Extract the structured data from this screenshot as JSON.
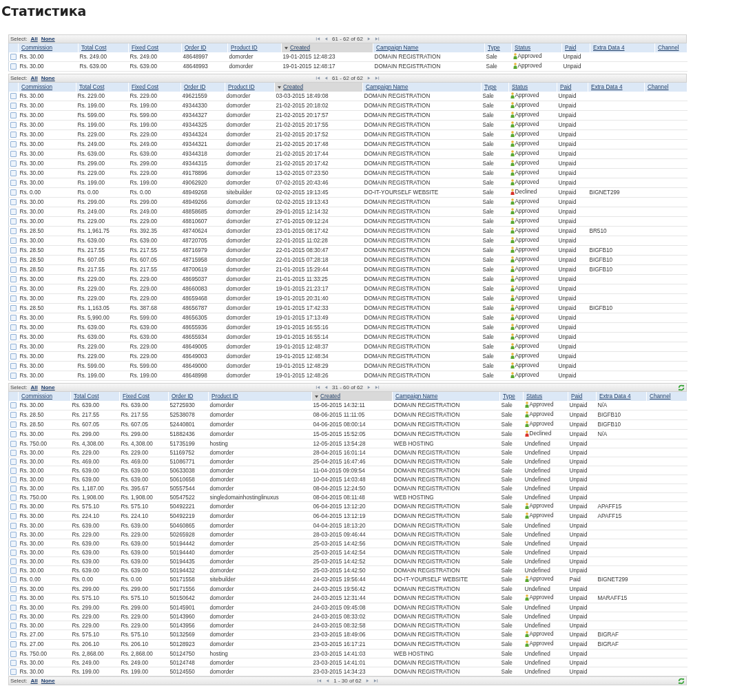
{
  "title": "Статистика",
  "grids": [
    {
      "toolbar": {
        "select_label": "Select:",
        "links": [
          "All",
          "None"
        ],
        "pager_text": "61 - 62 of 62",
        "refresh": false
      },
      "columns": [
        {
          "label": "Commission",
          "sorted": false
        },
        {
          "label": "Total Cost",
          "sorted": false
        },
        {
          "label": "Fixed Cost",
          "sorted": false
        },
        {
          "label": "Order ID",
          "sorted": false
        },
        {
          "label": "Product ID",
          "sorted": false
        },
        {
          "label": "Created",
          "sorted": true
        },
        {
          "label": "Campaign Name",
          "sorted": false
        },
        {
          "label": "Type",
          "sorted": false
        },
        {
          "label": "Status",
          "sorted": false
        },
        {
          "label": "Paid",
          "sorted": false
        },
        {
          "label": "Extra Data 4",
          "sorted": false
        },
        {
          "label": "Channel",
          "sorted": false
        }
      ],
      "rows": [
        {
          "checked": false,
          "kind": "approved",
          "cells": [
            "Rs. 30.00",
            "Rs. 249.00",
            "Rs. 249.00",
            "48648997",
            "domorder",
            "19-01-2015 12:48:23",
            "DOMAIN REGISTRATION",
            "Sale",
            "Approved",
            "Unpaid"
          ]
        },
        {
          "checked": false,
          "kind": "approved",
          "cells": [
            "Rs. 30.00",
            "Rs. 639.00",
            "Rs. 639.00",
            "48648993",
            "domorder",
            "19-01-2015 12:48:17",
            "DOMAIN REGISTRATION",
            "Sale",
            "Approved",
            "Unpaid"
          ]
        }
      ]
    },
    {
      "toolbar": {
        "select_label": "Select:",
        "links": [
          "All",
          "None"
        ],
        "pager_text": "61 - 62 of 62",
        "refresh": false
      },
      "columns": [
        {
          "label": "Commission",
          "sorted": false
        },
        {
          "label": "Total Cost",
          "sorted": false
        },
        {
          "label": "Fixed Cost",
          "sorted": false
        },
        {
          "label": "Order ID",
          "sorted": false
        },
        {
          "label": "Product ID",
          "sorted": false
        },
        {
          "label": "Created",
          "sorted": true
        },
        {
          "label": "Campaign Name",
          "sorted": false
        },
        {
          "label": "Type",
          "sorted": false
        },
        {
          "label": "Status",
          "sorted": false
        },
        {
          "label": "Paid",
          "sorted": false
        },
        {
          "label": "Extra Data 4",
          "sorted": false
        },
        {
          "label": "Channel",
          "sorted": false
        }
      ],
      "rows": [
        {
          "checked": false,
          "kind": "approved",
          "cells": [
            "Rs. 30.00",
            "Rs. 229.00",
            "Rs. 229.00",
            "49621559",
            "domorder",
            "03-03-2015 18:49:08",
            "DOMAIN REGISTRATION",
            "Sale",
            "Approved",
            "Unpaid"
          ]
        },
        {
          "checked": false,
          "kind": "approved",
          "cells": [
            "Rs. 30.00",
            "Rs. 199.00",
            "Rs. 199.00",
            "49344330",
            "domorder",
            "21-02-2015 20:18:02",
            "DOMAIN REGISTRATION",
            "Sale",
            "Approved",
            "Unpaid"
          ]
        },
        {
          "checked": false,
          "kind": "approved",
          "cells": [
            "Rs. 30.00",
            "Rs. 599.00",
            "Rs. 599.00",
            "49344327",
            "domorder",
            "21-02-2015 20:17:57",
            "DOMAIN REGISTRATION",
            "Sale",
            "Approved",
            "Unpaid"
          ]
        },
        {
          "checked": false,
          "kind": "approved",
          "cells": [
            "Rs. 30.00",
            "Rs. 199.00",
            "Rs. 199.00",
            "49344325",
            "domorder",
            "21-02-2015 20:17:55",
            "DOMAIN REGISTRATION",
            "Sale",
            "Approved",
            "Unpaid"
          ]
        },
        {
          "checked": false,
          "kind": "approved",
          "cells": [
            "Rs. 30.00",
            "Rs. 229.00",
            "Rs. 229.00",
            "49344324",
            "domorder",
            "21-02-2015 20:17:52",
            "DOMAIN REGISTRATION",
            "Sale",
            "Approved",
            "Unpaid"
          ]
        },
        {
          "checked": false,
          "kind": "approved",
          "cells": [
            "Rs. 30.00",
            "Rs. 249.00",
            "Rs. 249.00",
            "49344321",
            "domorder",
            "21-02-2015 20:17:48",
            "DOMAIN REGISTRATION",
            "Sale",
            "Approved",
            "Unpaid"
          ]
        },
        {
          "checked": false,
          "kind": "approved",
          "cells": [
            "Rs. 30.00",
            "Rs. 639.00",
            "Rs. 639.00",
            "49344318",
            "domorder",
            "21-02-2015 20:17:44",
            "DOMAIN REGISTRATION",
            "Sale",
            "Approved",
            "Unpaid"
          ]
        },
        {
          "checked": false,
          "kind": "approved",
          "cells": [
            "Rs. 30.00",
            "Rs. 299.00",
            "Rs. 299.00",
            "49344315",
            "domorder",
            "21-02-2015 20:17:42",
            "DOMAIN REGISTRATION",
            "Sale",
            "Approved",
            "Unpaid"
          ]
        },
        {
          "checked": false,
          "kind": "approved",
          "cells": [
            "Rs. 30.00",
            "Rs. 229.00",
            "Rs. 229.00",
            "49178896",
            "domorder",
            "13-02-2015 07:23:50",
            "DOMAIN REGISTRATION",
            "Sale",
            "Approved",
            "Unpaid"
          ]
        },
        {
          "checked": false,
          "kind": "approved",
          "cells": [
            "Rs. 30.00",
            "Rs. 199.00",
            "Rs. 199.00",
            "49062920",
            "domorder",
            "07-02-2015 20:43:46",
            "DOMAIN REGISTRATION",
            "Sale",
            "Approved",
            "Unpaid"
          ]
        },
        {
          "checked": false,
          "kind": "declined",
          "cells": [
            "Rs. 0.00",
            "Rs. 0.00",
            "Rs. 0.00",
            "48949268",
            "sitebuilder",
            "02-02-2015 19:13:45",
            "DO-IT-YOURSELF WEBSITE",
            "Sale",
            "Declined",
            "Unpaid"
          ],
          "extra_data_4": "BIGNET299"
        },
        {
          "checked": false,
          "kind": "approved",
          "cells": [
            "Rs. 30.00",
            "Rs. 299.00",
            "Rs. 299.00",
            "48949266",
            "domorder",
            "02-02-2015 19:13:43",
            "DOMAIN REGISTRATION",
            "Sale",
            "Approved",
            "Unpaid"
          ]
        },
        {
          "checked": false,
          "kind": "approved",
          "cells": [
            "Rs. 30.00",
            "Rs. 249.00",
            "Rs. 249.00",
            "48858685",
            "domorder",
            "29-01-2015 12:14:32",
            "DOMAIN REGISTRATION",
            "Sale",
            "Approved",
            "Unpaid"
          ]
        },
        {
          "checked": false,
          "kind": "approved",
          "cells": [
            "Rs. 30.00",
            "Rs. 229.00",
            "Rs. 229.00",
            "48810607",
            "domorder",
            "27-01-2015 09:12:24",
            "DOMAIN REGISTRATION",
            "Sale",
            "Approved",
            "Unpaid"
          ]
        },
        {
          "checked": false,
          "kind": "approved",
          "cells": [
            "Rs. 28.50",
            "Rs. 1,961.75",
            "Rs. 392.35",
            "48740624",
            "domorder",
            "23-01-2015 08:17:42",
            "DOMAIN REGISTRATION",
            "Sale",
            "Approved",
            "Unpaid"
          ],
          "extra_data_4": "BR510"
        },
        {
          "checked": false,
          "kind": "approved",
          "cells": [
            "Rs. 30.00",
            "Rs. 639.00",
            "Rs. 639.00",
            "48720705",
            "domorder",
            "22-01-2015 11:02:28",
            "DOMAIN REGISTRATION",
            "Sale",
            "Approved",
            "Unpaid"
          ]
        },
        {
          "checked": false,
          "kind": "approved",
          "cells": [
            "Rs. 28.50",
            "Rs. 217.55",
            "Rs. 217.55",
            "48716979",
            "domorder",
            "22-01-2015 08:30:47",
            "DOMAIN REGISTRATION",
            "Sale",
            "Approved",
            "Unpaid"
          ],
          "extra_data_4": "BIGFB10"
        },
        {
          "checked": false,
          "kind": "approved",
          "cells": [
            "Rs. 28.50",
            "Rs. 607.05",
            "Rs. 607.05",
            "48715958",
            "domorder",
            "22-01-2015 07:28:18",
            "DOMAIN REGISTRATION",
            "Sale",
            "Approved",
            "Unpaid"
          ],
          "extra_data_4": "BIGFB10"
        },
        {
          "checked": false,
          "kind": "approved",
          "cells": [
            "Rs. 28.50",
            "Rs. 217.55",
            "Rs. 217.55",
            "48700619",
            "domorder",
            "21-01-2015 15:29:44",
            "DOMAIN REGISTRATION",
            "Sale",
            "Approved",
            "Unpaid"
          ],
          "extra_data_4": "BIGFB10"
        },
        {
          "checked": false,
          "kind": "approved",
          "cells": [
            "Rs. 30.00",
            "Rs. 229.00",
            "Rs. 229.00",
            "48695037",
            "domorder",
            "21-01-2015 11:33:25",
            "DOMAIN REGISTRATION",
            "Sale",
            "Approved",
            "Unpaid"
          ]
        },
        {
          "checked": false,
          "kind": "approved",
          "cells": [
            "Rs. 30.00",
            "Rs. 229.00",
            "Rs. 229.00",
            "48660083",
            "domorder",
            "19-01-2015 21:23:17",
            "DOMAIN REGISTRATION",
            "Sale",
            "Approved",
            "Unpaid"
          ]
        },
        {
          "checked": false,
          "kind": "approved",
          "cells": [
            "Rs. 30.00",
            "Rs. 229.00",
            "Rs. 229.00",
            "48659468",
            "domorder",
            "19-01-2015 20:31:40",
            "DOMAIN REGISTRATION",
            "Sale",
            "Approved",
            "Unpaid"
          ]
        },
        {
          "checked": false,
          "kind": "approved",
          "cells": [
            "Rs. 28.50",
            "Rs. 1,163.05",
            "Rs. 387.68",
            "48656787",
            "domorder",
            "19-01-2015 17:42:33",
            "DOMAIN REGISTRATION",
            "Sale",
            "Approved",
            "Unpaid"
          ],
          "extra_data_4": "BIGFB10"
        },
        {
          "checked": false,
          "kind": "approved",
          "cells": [
            "Rs. 30.00",
            "Rs. 5,990.00",
            "Rs. 599.00",
            "48656305",
            "domorder",
            "19-01-2015 17:13:49",
            "DOMAIN REGISTRATION",
            "Sale",
            "Approved",
            "Unpaid"
          ]
        },
        {
          "checked": false,
          "kind": "approved",
          "cells": [
            "Rs. 30.00",
            "Rs. 639.00",
            "Rs. 639.00",
            "48655936",
            "domorder",
            "19-01-2015 16:55:16",
            "DOMAIN REGISTRATION",
            "Sale",
            "Approved",
            "Unpaid"
          ]
        },
        {
          "checked": false,
          "kind": "approved",
          "cells": [
            "Rs. 30.00",
            "Rs. 639.00",
            "Rs. 639.00",
            "48655934",
            "domorder",
            "19-01-2015 16:55:14",
            "DOMAIN REGISTRATION",
            "Sale",
            "Approved",
            "Unpaid"
          ]
        },
        {
          "checked": false,
          "kind": "approved",
          "cells": [
            "Rs. 30.00",
            "Rs. 229.00",
            "Rs. 229.00",
            "48649005",
            "domorder",
            "19-01-2015 12:48:37",
            "DOMAIN REGISTRATION",
            "Sale",
            "Approved",
            "Unpaid"
          ]
        },
        {
          "checked": false,
          "kind": "approved",
          "cells": [
            "Rs. 30.00",
            "Rs. 229.00",
            "Rs. 229.00",
            "48649003",
            "domorder",
            "19-01-2015 12:48:34",
            "DOMAIN REGISTRATION",
            "Sale",
            "Approved",
            "Unpaid"
          ]
        },
        {
          "checked": false,
          "kind": "approved",
          "cells": [
            "Rs. 30.00",
            "Rs. 599.00",
            "Rs. 599.00",
            "48649000",
            "domorder",
            "19-01-2015 12:48:29",
            "DOMAIN REGISTRATION",
            "Sale",
            "Approved",
            "Unpaid"
          ]
        },
        {
          "checked": false,
          "kind": "approved",
          "cells": [
            "Rs. 30.00",
            "Rs. 199.00",
            "Rs. 199.00",
            "48648998",
            "domorder",
            "19-01-2015 12:48:26",
            "DOMAIN REGISTRATION",
            "Sale",
            "Approved",
            "Unpaid"
          ]
        }
      ]
    },
    {
      "toolbar": {
        "select_label": "Select:",
        "links": [
          "All",
          "None"
        ],
        "pager_text": "31 - 60 of 62",
        "refresh": true
      },
      "columns": [
        {
          "label": "Commission",
          "sorted": false
        },
        {
          "label": "Total Cost",
          "sorted": false
        },
        {
          "label": "Fixed Cost",
          "sorted": false
        },
        {
          "label": "Order ID",
          "sorted": false
        },
        {
          "label": "Product ID",
          "sorted": false
        },
        {
          "label": "Created",
          "sorted": true
        },
        {
          "label": "Campaign Name",
          "sorted": false
        },
        {
          "label": "Type",
          "sorted": false
        },
        {
          "label": "Status",
          "sorted": false
        },
        {
          "label": "Paid",
          "sorted": false
        },
        {
          "label": "Extra Data 4",
          "sorted": false
        },
        {
          "label": "Channel",
          "sorted": false
        }
      ],
      "rows": [
        {
          "checked": false,
          "kind": "approved",
          "cells": [
            "Rs. 30.00",
            "Rs. 639.00",
            "Rs. 639.00",
            "52725930",
            "domorder",
            "15-06-2015 14:32:11",
            "DOMAIN REGISTRATION",
            "Sale",
            "Approved",
            "Unpaid"
          ],
          "extra_data_4": "N/A"
        },
        {
          "checked": false,
          "kind": "approved",
          "cells": [
            "Rs. 28.50",
            "Rs. 217.55",
            "Rs. 217.55",
            "52538078",
            "domorder",
            "08-06-2015 11:11:05",
            "DOMAIN REGISTRATION",
            "Sale",
            "Approved",
            "Unpaid"
          ],
          "extra_data_4": "BIGFB10"
        },
        {
          "checked": false,
          "kind": "approved",
          "cells": [
            "Rs. 28.50",
            "Rs. 607.05",
            "Rs. 607.05",
            "52440801",
            "domorder",
            "04-06-2015 08:00:14",
            "DOMAIN REGISTRATION",
            "Sale",
            "Approved",
            "Unpaid"
          ],
          "extra_data_4": "BIGFB10"
        },
        {
          "checked": false,
          "kind": "declined",
          "cells": [
            "Rs. 30.00",
            "Rs. 299.00",
            "Rs. 299.00",
            "51882436",
            "domorder",
            "15-05-2015 15:52:05",
            "DOMAIN REGISTRATION",
            "Sale",
            "Declined",
            "Unpaid"
          ],
          "extra_data_4": "N/A"
        },
        {
          "checked": false,
          "kind": "undefined",
          "cells": [
            "Rs. 750.00",
            "Rs. 4,308.00",
            "Rs. 4,308.00",
            "51735199",
            "hosting",
            "12-05-2015 13:54:28",
            "WEB HOSTING",
            "Sale",
            "Undefined",
            "Unpaid"
          ]
        },
        {
          "checked": false,
          "kind": "undefined",
          "cells": [
            "Rs. 30.00",
            "Rs. 229.00",
            "Rs. 229.00",
            "51169752",
            "domorder",
            "28-04-2015 16:01:14",
            "DOMAIN REGISTRATION",
            "Sale",
            "Undefined",
            "Unpaid"
          ]
        },
        {
          "checked": false,
          "kind": "undefined",
          "cells": [
            "Rs. 30.00",
            "Rs. 469.00",
            "Rs. 469.00",
            "51086771",
            "domorder",
            "25-04-2015 16:47:46",
            "DOMAIN REGISTRATION",
            "Sale",
            "Undefined",
            "Unpaid"
          ]
        },
        {
          "checked": false,
          "kind": "undefined",
          "cells": [
            "Rs. 30.00",
            "Rs. 639.00",
            "Rs. 639.00",
            "50633038",
            "domorder",
            "11-04-2015 09:09:54",
            "DOMAIN REGISTRATION",
            "Sale",
            "Undefined",
            "Unpaid"
          ]
        },
        {
          "checked": false,
          "kind": "undefined",
          "cells": [
            "Rs. 30.00",
            "Rs. 639.00",
            "Rs. 639.00",
            "50610658",
            "domorder",
            "10-04-2015 14:03:48",
            "DOMAIN REGISTRATION",
            "Sale",
            "Undefined",
            "Unpaid"
          ]
        },
        {
          "checked": false,
          "kind": "undefined",
          "cells": [
            "Rs. 30.00",
            "Rs. 1,187.00",
            "Rs. 395.67",
            "50557544",
            "domorder",
            "08-04-2015 12:24:50",
            "DOMAIN REGISTRATION",
            "Sale",
            "Undefined",
            "Unpaid"
          ]
        },
        {
          "checked": false,
          "kind": "undefined",
          "cells": [
            "Rs. 750.00",
            "Rs. 1,908.00",
            "Rs. 1,908.00",
            "50547522",
            "singledomainhostinglinuxus",
            "08-04-2015 08:11:48",
            "WEB HOSTING",
            "Sale",
            "Undefined",
            "Unpaid"
          ]
        },
        {
          "checked": false,
          "kind": "approved",
          "cells": [
            "Rs. 30.00",
            "Rs. 575.10",
            "Rs. 575.10",
            "50492221",
            "domorder",
            "06-04-2015 13:12:20",
            "DOMAIN REGISTRATION",
            "Sale",
            "Approved",
            "Unpaid"
          ],
          "extra_data_4": "APAFF15"
        },
        {
          "checked": false,
          "kind": "approved",
          "cells": [
            "Rs. 30.00",
            "Rs. 224.10",
            "Rs. 224.10",
            "50492219",
            "domorder",
            "06-04-2015 13:12:19",
            "DOMAIN REGISTRATION",
            "Sale",
            "Approved",
            "Unpaid"
          ],
          "extra_data_4": "APAFF15"
        },
        {
          "checked": false,
          "kind": "undefined",
          "cells": [
            "Rs. 30.00",
            "Rs. 639.00",
            "Rs. 639.00",
            "50460865",
            "domorder",
            "04-04-2015 18:13:20",
            "DOMAIN REGISTRATION",
            "Sale",
            "Undefined",
            "Unpaid"
          ]
        },
        {
          "checked": false,
          "kind": "undefined",
          "cells": [
            "Rs. 30.00",
            "Rs. 229.00",
            "Rs. 229.00",
            "50265928",
            "domorder",
            "28-03-2015 09:46:44",
            "DOMAIN REGISTRATION",
            "Sale",
            "Undefined",
            "Unpaid"
          ]
        },
        {
          "checked": false,
          "kind": "undefined",
          "cells": [
            "Rs. 30.00",
            "Rs. 639.00",
            "Rs. 639.00",
            "50194442",
            "domorder",
            "25-03-2015 14:42:56",
            "DOMAIN REGISTRATION",
            "Sale",
            "Undefined",
            "Unpaid"
          ]
        },
        {
          "checked": false,
          "kind": "undefined",
          "cells": [
            "Rs. 30.00",
            "Rs. 639.00",
            "Rs. 639.00",
            "50194440",
            "domorder",
            "25-03-2015 14:42:54",
            "DOMAIN REGISTRATION",
            "Sale",
            "Undefined",
            "Unpaid"
          ]
        },
        {
          "checked": false,
          "kind": "undefined",
          "cells": [
            "Rs. 30.00",
            "Rs. 639.00",
            "Rs. 639.00",
            "50194435",
            "domorder",
            "25-03-2015 14:42:52",
            "DOMAIN REGISTRATION",
            "Sale",
            "Undefined",
            "Unpaid"
          ]
        },
        {
          "checked": false,
          "kind": "undefined",
          "cells": [
            "Rs. 30.00",
            "Rs. 639.00",
            "Rs. 639.00",
            "50194432",
            "domorder",
            "25-03-2015 14:42:50",
            "DOMAIN REGISTRATION",
            "Sale",
            "Undefined",
            "Unpaid"
          ]
        },
        {
          "checked": false,
          "kind": "approved",
          "cells": [
            "Rs. 0.00",
            "Rs. 0.00",
            "Rs. 0.00",
            "50171558",
            "sitebuilder",
            "24-03-2015 19:56:44",
            "DO-IT-YOURSELF WEBSITE",
            "Sale",
            "Approved",
            "Paid"
          ],
          "extra_data_4": "BIGNET299"
        },
        {
          "checked": false,
          "kind": "undefined",
          "cells": [
            "Rs. 30.00",
            "Rs. 299.00",
            "Rs. 299.00",
            "50171556",
            "domorder",
            "24-03-2015 19:56:42",
            "DOMAIN REGISTRATION",
            "Sale",
            "Undefined",
            "Unpaid"
          ]
        },
        {
          "checked": false,
          "kind": "approved",
          "cells": [
            "Rs. 30.00",
            "Rs. 575.10",
            "Rs. 575.10",
            "50150642",
            "domorder",
            "24-03-2015 12:31:44",
            "DOMAIN REGISTRATION",
            "Sale",
            "Approved",
            "Unpaid"
          ],
          "extra_data_4": "MARAFF15"
        },
        {
          "checked": false,
          "kind": "undefined",
          "cells": [
            "Rs. 30.00",
            "Rs. 299.00",
            "Rs. 299.00",
            "50145901",
            "domorder",
            "24-03-2015 09:45:08",
            "DOMAIN REGISTRATION",
            "Sale",
            "Undefined",
            "Unpaid"
          ]
        },
        {
          "checked": false,
          "kind": "undefined",
          "cells": [
            "Rs. 30.00",
            "Rs. 229.00",
            "Rs. 229.00",
            "50143960",
            "domorder",
            "24-03-2015 08:33:02",
            "DOMAIN REGISTRATION",
            "Sale",
            "Undefined",
            "Unpaid"
          ]
        },
        {
          "checked": false,
          "kind": "undefined",
          "cells": [
            "Rs. 30.00",
            "Rs. 229.00",
            "Rs. 229.00",
            "50143956",
            "domorder",
            "24-03-2015 08:32:58",
            "DOMAIN REGISTRATION",
            "Sale",
            "Undefined",
            "Unpaid"
          ]
        },
        {
          "checked": false,
          "kind": "approved",
          "cells": [
            "Rs. 27.00",
            "Rs. 575.10",
            "Rs. 575.10",
            "50132569",
            "domorder",
            "23-03-2015 18:49:06",
            "DOMAIN REGISTRATION",
            "Sale",
            "Approved",
            "Unpaid"
          ],
          "extra_data_4": "BIGRAF"
        },
        {
          "checked": false,
          "kind": "approved",
          "cells": [
            "Rs. 27.00",
            "Rs. 206.10",
            "Rs. 206.10",
            "50128923",
            "domorder",
            "23-03-2015 16:17:21",
            "DOMAIN REGISTRATION",
            "Sale",
            "Approved",
            "Unpaid"
          ],
          "extra_data_4": "BIGRAF"
        },
        {
          "checked": false,
          "kind": "undefined",
          "cells": [
            "Rs. 750.00",
            "Rs. 2,868.00",
            "Rs. 2,868.00",
            "50124750",
            "hosting",
            "23-03-2015 14:41:03",
            "WEB HOSTING",
            "Sale",
            "Undefined",
            "Unpaid"
          ]
        },
        {
          "checked": false,
          "kind": "undefined",
          "cells": [
            "Rs. 30.00",
            "Rs. 249.00",
            "Rs. 249.00",
            "50124748",
            "domorder",
            "23-03-2015 14:41:01",
            "DOMAIN REGISTRATION",
            "Sale",
            "Undefined",
            "Unpaid"
          ]
        },
        {
          "checked": false,
          "kind": "undefined",
          "cells": [
            "Rs. 30.00",
            "Rs. 199.00",
            "Rs. 199.00",
            "50124550",
            "domorder",
            "23-03-2015 14:34:23",
            "DOMAIN REGISTRATION",
            "Sale",
            "Undefined",
            "Unpaid"
          ]
        }
      ],
      "footer": {
        "select_label": "Select:",
        "links": [
          "All",
          "None"
        ],
        "pager_text": "1 - 30 of 62",
        "refresh": true
      }
    }
  ]
}
